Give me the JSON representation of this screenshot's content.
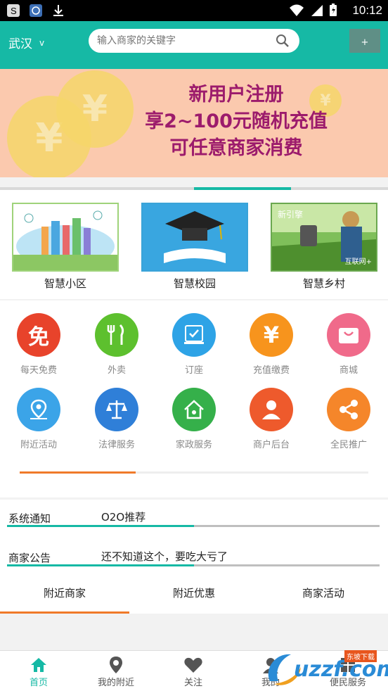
{
  "status_bar": {
    "time": "10:12",
    "icons": [
      "s-app-icon",
      "sync-app-icon",
      "download-icon",
      "wifi-icon",
      "signal-icon",
      "battery-icon"
    ]
  },
  "header": {
    "city": "武汉",
    "city_chevron": "v",
    "search_placeholder": "输入商家的关键字",
    "plus_label": "+"
  },
  "banner": {
    "lines": [
      "新用户注册",
      "享2~100元随机充值",
      "可任意商家消费"
    ],
    "coin_glyph": "¥"
  },
  "cards": [
    {
      "label": "智慧小区"
    },
    {
      "label": "智慧校园"
    },
    {
      "label": "智慧乡村",
      "pic_text_1": "新引擎",
      "pic_text_2": "互联网+"
    }
  ],
  "grid": [
    {
      "label": "每天免费",
      "glyph": "免",
      "color": "#e8432b",
      "icon": "free-icon"
    },
    {
      "label": "外卖",
      "glyph": "",
      "color": "#5dc02e",
      "icon": "fork-knife-icon"
    },
    {
      "label": "订座",
      "glyph": "",
      "color": "#2ea3e6",
      "icon": "reserve-icon"
    },
    {
      "label": "充值缴费",
      "glyph": "¥",
      "color": "#f7941d",
      "icon": "yuan-icon"
    },
    {
      "label": "商城",
      "glyph": "",
      "color": "#f06a8a",
      "icon": "shopping-bag-icon"
    },
    {
      "label": "附近活动",
      "glyph": "",
      "color": "#3ba4e8",
      "icon": "location-icon"
    },
    {
      "label": "法律服务",
      "glyph": "",
      "color": "#2f7fd8",
      "icon": "scales-icon"
    },
    {
      "label": "家政服务",
      "glyph": "",
      "color": "#35b04a",
      "icon": "home-service-icon"
    },
    {
      "label": "商户后台",
      "glyph": "",
      "color": "#ee5a2c",
      "icon": "merchant-user-icon"
    },
    {
      "label": "全民推广",
      "glyph": "",
      "color": "#f5862a",
      "icon": "share-icon"
    }
  ],
  "notices": [
    {
      "label": "系统通知",
      "value": "O2O推荐"
    },
    {
      "label": "商家公告",
      "value": "还不知道这个，要吃大亏了"
    }
  ],
  "tabs": [
    {
      "label": "附近商家"
    },
    {
      "label": "附近优惠"
    },
    {
      "label": "商家活动"
    }
  ],
  "bottom_nav": [
    {
      "label": "首页",
      "icon": "home-icon"
    },
    {
      "label": "我的附近",
      "icon": "map-pin-icon"
    },
    {
      "label": "关注",
      "icon": "heart-icon"
    },
    {
      "label": "我的",
      "icon": "user-icon"
    },
    {
      "label": "便民服务",
      "icon": "service-icon"
    }
  ],
  "watermark": {
    "text": "uzzf.com",
    "sub": "东坡下载"
  },
  "colors": {
    "primary": "#16b9a5",
    "accent": "#f07a2a",
    "banner_bg": "#fbc9ae",
    "banner_text": "#9c1b6c"
  }
}
